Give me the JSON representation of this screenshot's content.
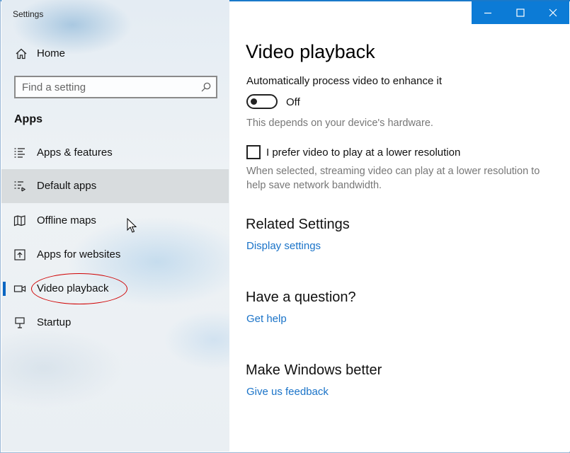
{
  "window": {
    "title": "Settings"
  },
  "colors": {
    "accent": "#0c7bd6",
    "link": "#1a73c8",
    "annotation": "#d00000"
  },
  "sidebar": {
    "home_label": "Home",
    "search": {
      "placeholder": "Find a setting",
      "value": ""
    },
    "section": "Apps",
    "items": [
      {
        "label": "Apps & features",
        "icon": "list-icon"
      },
      {
        "label": "Default apps",
        "icon": "default-apps-icon",
        "hovered": true
      },
      {
        "label": "Offline maps",
        "icon": "map-icon"
      },
      {
        "label": "Apps for websites",
        "icon": "open-in-window-icon"
      },
      {
        "label": "Video playback",
        "icon": "video-icon",
        "selected": true
      },
      {
        "label": "Startup",
        "icon": "startup-icon"
      }
    ]
  },
  "main": {
    "title": "Video playback",
    "auto_process": {
      "label": "Automatically process video to enhance it",
      "toggle_state": "Off",
      "note": "This depends on your device's hardware."
    },
    "low_res": {
      "label": "I prefer video to play at a lower resolution",
      "checked": false,
      "note_line1": "When selected, streaming video can play at a lower resolution to",
      "note_line2": "help save network bandwidth."
    },
    "related": {
      "heading": "Related Settings",
      "link": "Display settings"
    },
    "question": {
      "heading": "Have a question?",
      "link": "Get help"
    },
    "better": {
      "heading": "Make Windows better",
      "link": "Give us feedback"
    }
  },
  "caption_buttons": [
    "minimize-icon",
    "maximize-icon",
    "close-icon"
  ]
}
